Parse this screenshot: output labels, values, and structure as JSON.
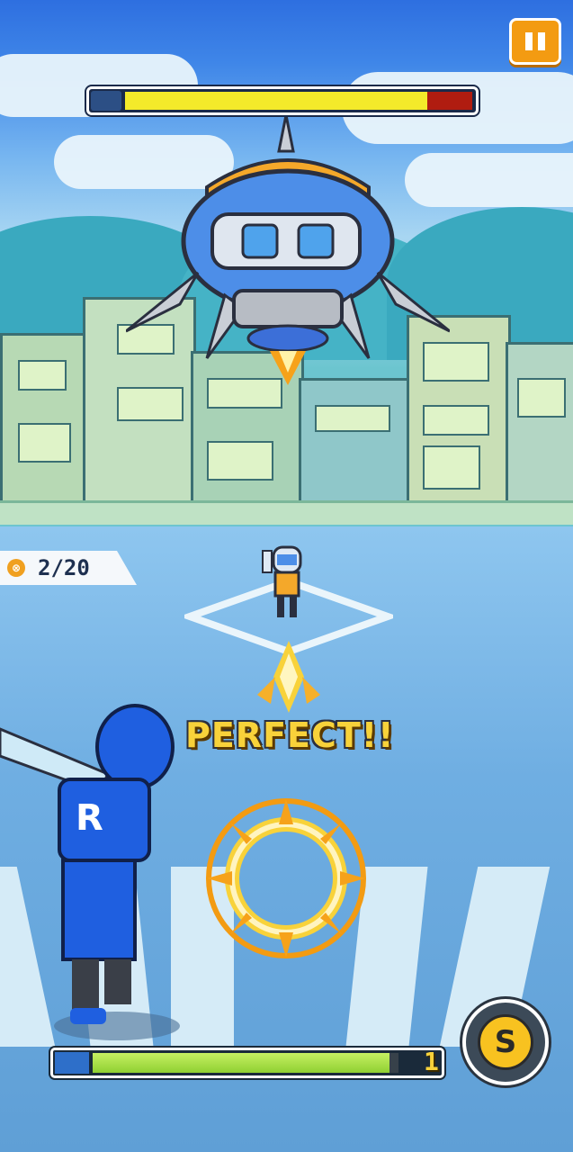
{
  "hud": {
    "pause_icon": "pause-icon",
    "boss_health": 0.87,
    "boss_icon": "ufo-icon"
  },
  "counter": {
    "icon": "ball-icon",
    "text": "2/20"
  },
  "feedback": {
    "text": "PERFECT!!"
  },
  "player": {
    "jersey_letter": "R"
  },
  "power": {
    "icon": "bat-icon",
    "fill": 0.97,
    "count": "1"
  },
  "skill": {
    "letter": "S"
  },
  "colors": {
    "accent": "#f39b12",
    "boss_fill": "#f4ea2a",
    "power_fill": "#8fd032",
    "perfect_text": "#f8d23a"
  }
}
